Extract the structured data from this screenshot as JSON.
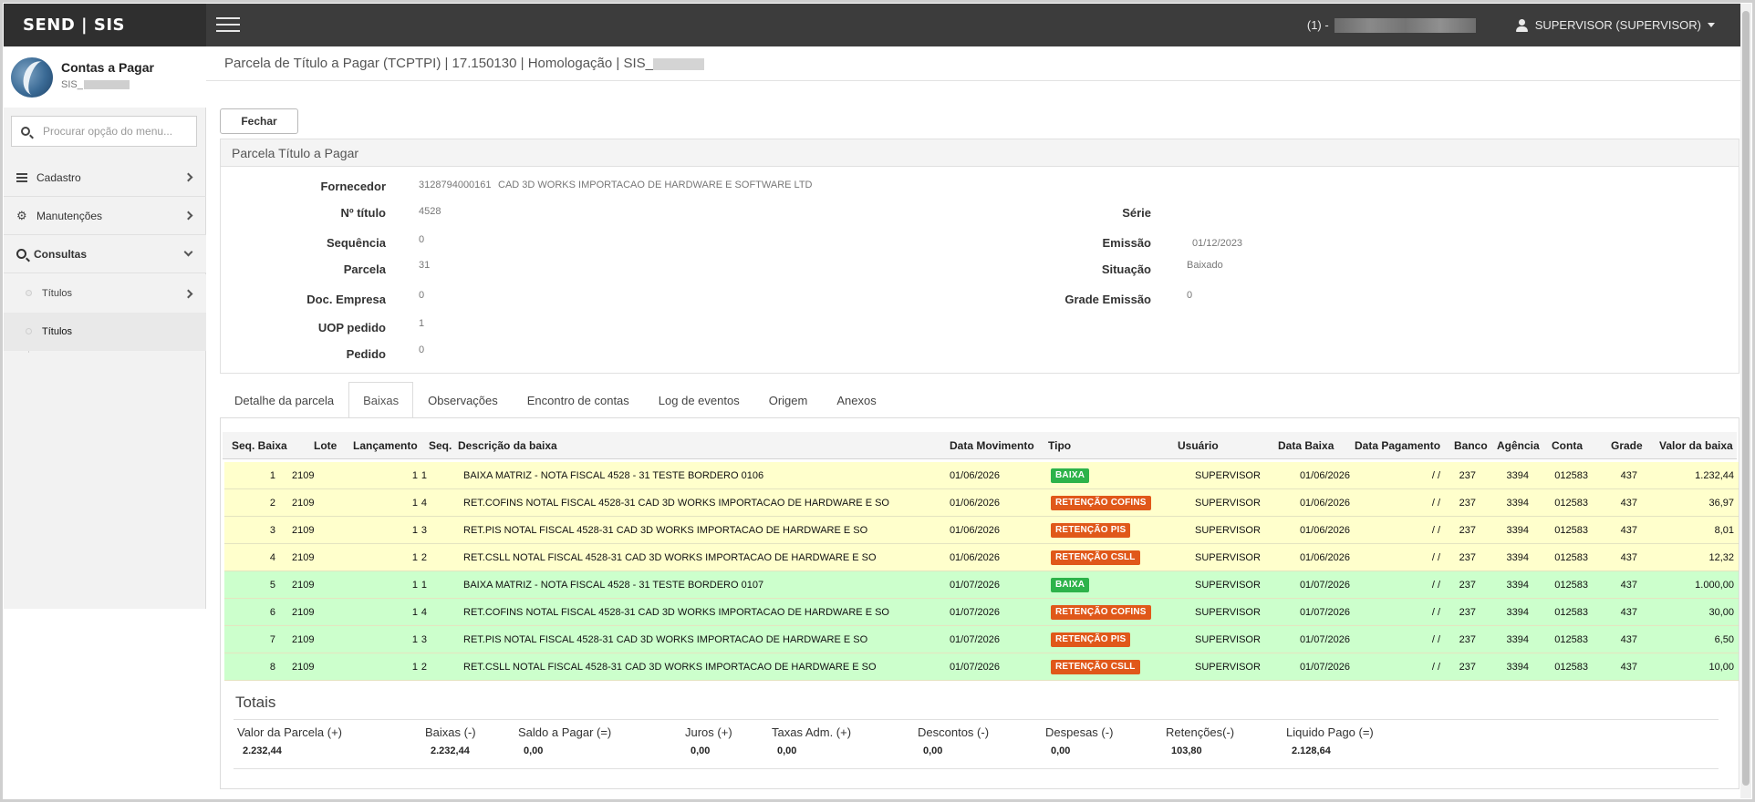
{
  "topbar": {
    "brand": "SEND | SIS",
    "env_label": "(1) -",
    "user_label": "SUPERVISOR (SUPERVISOR)"
  },
  "sidebar": {
    "module_title": "Contas a Pagar",
    "module_sub": "SIS_",
    "search_placeholder": "Procurar opção do menu...",
    "items": [
      {
        "label": "Cadastro",
        "icon": "list-icon"
      },
      {
        "label": "Manutenções",
        "icon": "gears-icon"
      },
      {
        "label": "Consultas",
        "icon": "search-icon"
      }
    ],
    "sub_items": [
      {
        "label": "Títulos"
      },
      {
        "label": "Títulos"
      }
    ]
  },
  "main": {
    "page_title": "Parcela de Título a Pagar (TCPTPI) | 17.150130 | Homologação | SIS_",
    "close_button": "Fechar",
    "panel_title": "Parcela Título a Pagar",
    "fields": {
      "fornecedor_label": "Fornecedor",
      "fornecedor_code": "3128794000161",
      "fornecedor_name": "CAD 3D WORKS IMPORTACAO DE HARDWARE E SOFTWARE LTD",
      "titulo_label": "Nº título",
      "titulo_value": "4528",
      "sequencia_label": "Sequência",
      "sequencia_value": "0",
      "parcela_label": "Parcela",
      "parcela_value": "31",
      "doc_empresa_label": "Doc. Empresa",
      "doc_empresa_value": "0",
      "uop_label": "UOP pedido",
      "uop_value": "1",
      "pedido_label": "Pedido",
      "pedido_value": "0",
      "serie_label": "Série",
      "serie_value": "",
      "emissao_label": "Emissão",
      "emissao_value": "01/12/2023",
      "situacao_label": "Situação",
      "situacao_value": "Baixado",
      "grade_emissao_label": "Grade Emissão",
      "grade_emissao_value": "0"
    },
    "tabs": [
      {
        "label": "Detalhe da parcela"
      },
      {
        "label": "Baixas"
      },
      {
        "label": "Observações"
      },
      {
        "label": "Encontro de contas"
      },
      {
        "label": "Log de eventos"
      },
      {
        "label": "Origem"
      },
      {
        "label": "Anexos"
      }
    ],
    "active_tab": "Baixas",
    "grid": {
      "columns": [
        "Seq. Baixa",
        "Lote",
        "Lançamento",
        "Seq.",
        "Descrição da baixa",
        "Data Movimento",
        "Tipo",
        "Usuário",
        "Data Baixa",
        "Data Pagamento",
        "Banco",
        "Agência",
        "Conta",
        "Grade",
        "Valor da baixa"
      ],
      "rows": [
        {
          "seq_baixa": "1",
          "lote": "2109",
          "lancamento": "1",
          "seq": "1",
          "descricao": "BAIXA MATRIZ - NOTA FISCAL 4528 - 31 TESTE BORDERO 0106",
          "data_mov": "01/06/2026",
          "tipo": "BAIXA",
          "tipo_color": "#2db34a",
          "usuario": "SUPERVISOR",
          "data_baixa": "01/06/2026",
          "data_pag": "/ /",
          "banco": "237",
          "agencia": "3394",
          "conta": "012583",
          "grade": "437",
          "valor": "1.232,44",
          "row_color": "#ffffcc"
        },
        {
          "seq_baixa": "2",
          "lote": "2109",
          "lancamento": "1",
          "seq": "4",
          "descricao": "RET.COFINS NOTAL FISCAL 4528-31 CAD 3D WORKS IMPORTACAO DE HARDWARE E SO",
          "data_mov": "01/06/2026",
          "tipo": "RETENÇÃO COFINS",
          "tipo_color": "#e0581a",
          "usuario": "SUPERVISOR",
          "data_baixa": "01/06/2026",
          "data_pag": "/ /",
          "banco": "237",
          "agencia": "3394",
          "conta": "012583",
          "grade": "437",
          "valor": "36,97",
          "row_color": "#ffffcc"
        },
        {
          "seq_baixa": "3",
          "lote": "2109",
          "lancamento": "1",
          "seq": "3",
          "descricao": "RET.PIS NOTAL FISCAL 4528-31 CAD 3D WORKS IMPORTACAO DE HARDWARE E SO",
          "data_mov": "01/06/2026",
          "tipo": "RETENÇÃO PIS",
          "tipo_color": "#e0581a",
          "usuario": "SUPERVISOR",
          "data_baixa": "01/06/2026",
          "data_pag": "/ /",
          "banco": "237",
          "agencia": "3394",
          "conta": "012583",
          "grade": "437",
          "valor": "8,01",
          "row_color": "#ffffcc"
        },
        {
          "seq_baixa": "4",
          "lote": "2109",
          "lancamento": "1",
          "seq": "2",
          "descricao": "RET.CSLL NOTAL FISCAL 4528-31 CAD 3D WORKS IMPORTACAO DE HARDWARE E SO",
          "data_mov": "01/06/2026",
          "tipo": "RETENÇÃO CSLL",
          "tipo_color": "#e0581a",
          "usuario": "SUPERVISOR",
          "data_baixa": "01/06/2026",
          "data_pag": "/ /",
          "banco": "237",
          "agencia": "3394",
          "conta": "012583",
          "grade": "437",
          "valor": "12,32",
          "row_color": "#ffffcc"
        },
        {
          "seq_baixa": "5",
          "lote": "2109",
          "lancamento": "1",
          "seq": "1",
          "descricao": "BAIXA MATRIZ - NOTA FISCAL 4528 - 31 TESTE BORDERO 0107",
          "data_mov": "01/07/2026",
          "tipo": "BAIXA",
          "tipo_color": "#2db34a",
          "usuario": "SUPERVISOR",
          "data_baixa": "01/07/2026",
          "data_pag": "/ /",
          "banco": "237",
          "agencia": "3394",
          "conta": "012583",
          "grade": "437",
          "valor": "1.000,00",
          "row_color": "#ccffcc"
        },
        {
          "seq_baixa": "6",
          "lote": "2109",
          "lancamento": "1",
          "seq": "4",
          "descricao": "RET.COFINS NOTAL FISCAL 4528-31 CAD 3D WORKS IMPORTACAO DE HARDWARE E SO",
          "data_mov": "01/07/2026",
          "tipo": "RETENÇÃO COFINS",
          "tipo_color": "#e0581a",
          "usuario": "SUPERVISOR",
          "data_baixa": "01/07/2026",
          "data_pag": "/ /",
          "banco": "237",
          "agencia": "3394",
          "conta": "012583",
          "grade": "437",
          "valor": "30,00",
          "row_color": "#ccffcc"
        },
        {
          "seq_baixa": "7",
          "lote": "2109",
          "lancamento": "1",
          "seq": "3",
          "descricao": "RET.PIS NOTAL FISCAL 4528-31 CAD 3D WORKS IMPORTACAO DE HARDWARE E SO",
          "data_mov": "01/07/2026",
          "tipo": "RETENÇÃO PIS",
          "tipo_color": "#e0581a",
          "usuario": "SUPERVISOR",
          "data_baixa": "01/07/2026",
          "data_pag": "/ /",
          "banco": "237",
          "agencia": "3394",
          "conta": "012583",
          "grade": "437",
          "valor": "6,50",
          "row_color": "#ccffcc"
        },
        {
          "seq_baixa": "8",
          "lote": "2109",
          "lancamento": "1",
          "seq": "2",
          "descricao": "RET.CSLL NOTAL FISCAL 4528-31 CAD 3D WORKS IMPORTACAO DE HARDWARE E SO",
          "data_mov": "01/07/2026",
          "tipo": "RETENÇÃO CSLL",
          "tipo_color": "#e0581a",
          "usuario": "SUPERVISOR",
          "data_baixa": "01/07/2026",
          "data_pag": "/ /",
          "banco": "237",
          "agencia": "3394",
          "conta": "012583",
          "grade": "437",
          "valor": "10,00",
          "row_color": "#ccffcc"
        }
      ]
    },
    "totals": {
      "title": "Totais",
      "items": [
        {
          "label": "Valor da Parcela (+)",
          "value": "2.232,44"
        },
        {
          "label": "Baixas (-)",
          "value": "2.232,44"
        },
        {
          "label": "Saldo a Pagar (=)",
          "value": "0,00"
        },
        {
          "label": "Juros (+)",
          "value": "0,00"
        },
        {
          "label": "Taxas Adm. (+)",
          "value": "0,00"
        },
        {
          "label": "Descontos (-)",
          "value": "0,00"
        },
        {
          "label": "Despesas (-)",
          "value": "0,00"
        },
        {
          "label": "Retenções(-)",
          "value": "103,80"
        },
        {
          "label": "Liquido Pago (=)",
          "value": "2.128,64"
        }
      ]
    }
  }
}
